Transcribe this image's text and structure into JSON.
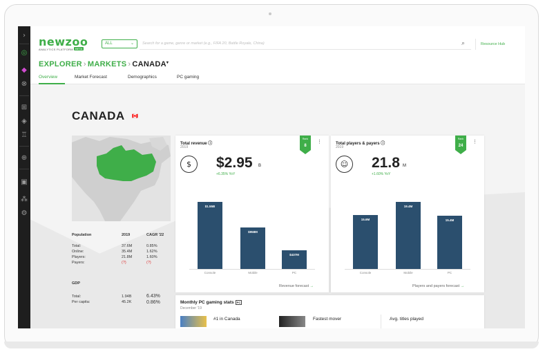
{
  "brand": {
    "logo": "newzoo",
    "subtitle": "ANALYTICS PLATFORM",
    "badge": "BETA",
    "accent_color": "#3fae49",
    "bar_color": "#2b4f6e"
  },
  "toolbar": {
    "filter_value": "ALL",
    "search_placeholder": "Search for a game, genre or market (e.g., FIFA 20, Battle Royale, China)",
    "resource_hub_label": "Resource Hub"
  },
  "breadcrumb": {
    "root": "EXPLORER",
    "section": "MARKETS",
    "current": "CANADA"
  },
  "tabs": [
    {
      "label": "Overview",
      "active": true
    },
    {
      "label": "Market Forecast",
      "active": false
    },
    {
      "label": "Demographics",
      "active": false
    },
    {
      "label": "PC gaming",
      "active": false
    }
  ],
  "sidebar_icons": [
    "chevron-right-icon",
    "globe-icon",
    "tag-icon",
    "compass-icon",
    "gamepad-icon",
    "shield-icon",
    "trophy-icon",
    "target-icon",
    "video-icon",
    "people-icon",
    "settings-icon"
  ],
  "country": {
    "name": "CANADA",
    "flag": "🇨🇦"
  },
  "stats": {
    "headers": [
      "Population",
      "2019",
      "CAGR '22"
    ],
    "rows": [
      {
        "label": "Total:",
        "value": "37.6M",
        "cagr": "0.85%"
      },
      {
        "label": "Online:",
        "value": "35.4M",
        "cagr": "1.62%"
      },
      {
        "label": "Players:",
        "value": "21.8M",
        "cagr": "1.60%"
      },
      {
        "label": "Payers:",
        "value": "(?)",
        "cagr": "(?)"
      }
    ],
    "gdp_header": "GDP",
    "gdp_rows": [
      {
        "label": "Total:",
        "value": "1.94B",
        "cagr": "6.43%"
      },
      {
        "label": "Per capita:",
        "value": "45.2K",
        "cagr": "0.86%"
      }
    ]
  },
  "revenue_card": {
    "title": "Total revenue",
    "year": "2019",
    "rank_label": "Rank",
    "rank": "8",
    "value": "$2.95",
    "unit": "B",
    "growth": "+6.35% YoY",
    "link": "Revenue forecast"
  },
  "players_card": {
    "title": "Total players & payers",
    "year": "2019",
    "rank_label": "Rank",
    "rank": "24",
    "value": "21.8",
    "unit": "M",
    "growth": "+1.60% YoY",
    "link": "Players and payers forecast"
  },
  "monthly_card": {
    "title": "Monthly PC gaming stats",
    "tag": "PC",
    "month": "December '19",
    "item1": "#1 in Canada",
    "item2": "Fastest mover",
    "item3": "Avg. titles played"
  },
  "chart_data": [
    {
      "type": "bar",
      "categories": [
        "Console",
        "Mobile",
        "PC"
      ],
      "values": [
        1.55,
        0.958,
        0.437
      ],
      "value_labels": [
        "$1.55B",
        "$958M",
        "$437M"
      ],
      "ylim": [
        0,
        1.6
      ]
    },
    {
      "type": "bar",
      "categories": [
        "Console",
        "Mobile",
        "PC"
      ],
      "values": [
        15.6,
        19.4,
        15.4
      ],
      "value_labels": [
        "15.6M",
        "19.4M",
        "15.4M"
      ],
      "ylim": [
        0,
        20
      ]
    }
  ]
}
